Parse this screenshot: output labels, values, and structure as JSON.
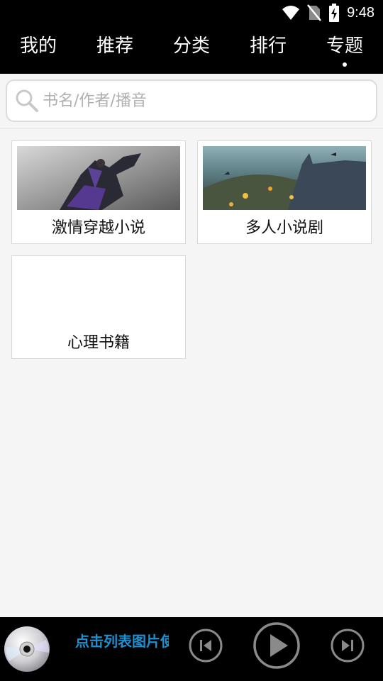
{
  "status_bar": {
    "time": "9:48"
  },
  "tabs": [
    {
      "label": "我的",
      "active": false
    },
    {
      "label": "推荐",
      "active": false
    },
    {
      "label": "分类",
      "active": false
    },
    {
      "label": "排行",
      "active": false
    },
    {
      "label": "专题",
      "active": true
    }
  ],
  "search": {
    "placeholder": "书名/作者/播音"
  },
  "topics": [
    {
      "title": "激情穿越小说"
    },
    {
      "title": "多人小说剧"
    },
    {
      "title": "心理书籍"
    }
  ],
  "player": {
    "marquee": "点击列表图片使",
    "accent_color": "#1e90d0"
  }
}
